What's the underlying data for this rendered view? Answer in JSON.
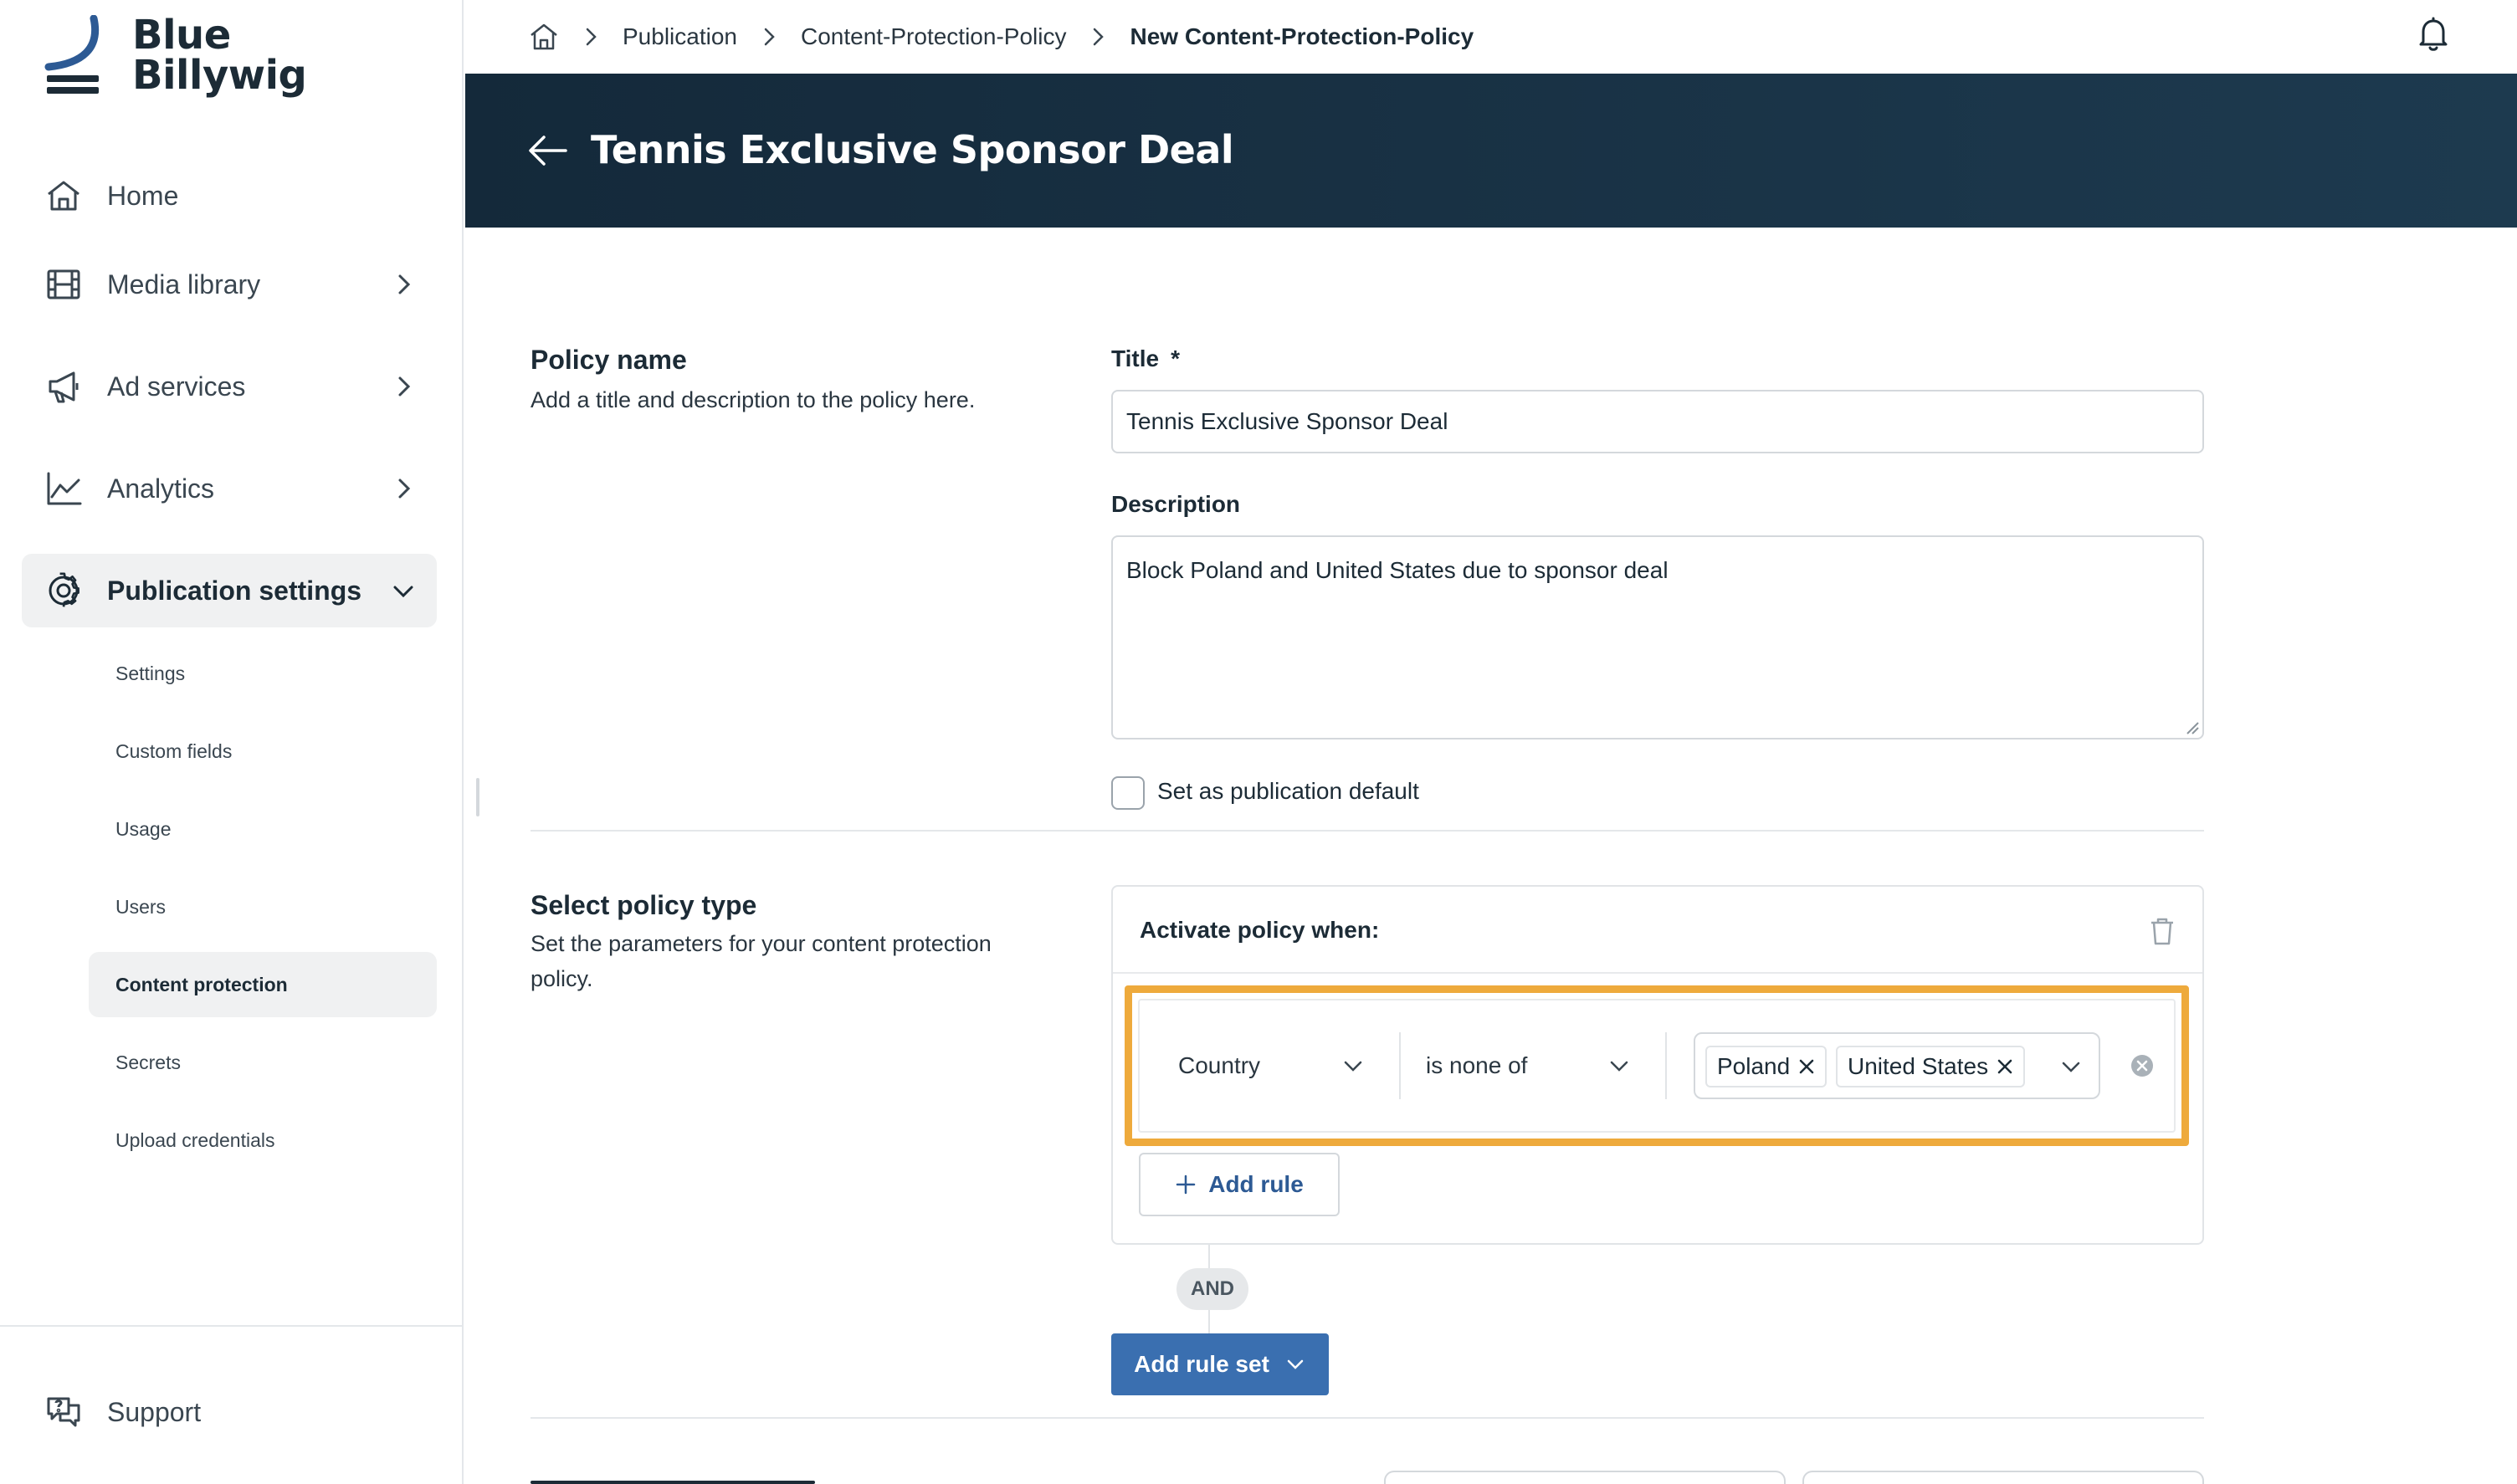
{
  "app": {
    "logo_line1": "Blue",
    "logo_line2": "Billywig"
  },
  "sidebar": {
    "items": [
      {
        "label": "Home",
        "icon": "home-icon"
      },
      {
        "label": "Media library",
        "icon": "film-icon"
      },
      {
        "label": "Ad services",
        "icon": "megaphone-icon"
      },
      {
        "label": "Analytics",
        "icon": "chart-line-icon"
      },
      {
        "label": "Publication settings",
        "icon": "gear-icon",
        "active": true
      }
    ],
    "sub_items": [
      {
        "label": "Settings"
      },
      {
        "label": "Custom fields"
      },
      {
        "label": "Usage"
      },
      {
        "label": "Users"
      },
      {
        "label": "Content protection",
        "active": true
      },
      {
        "label": "Secrets"
      },
      {
        "label": "Upload credentials"
      }
    ],
    "support_label": "Support"
  },
  "breadcrumb": {
    "items": [
      "Publication",
      "Content-Protection-Policy",
      "New Content-Protection-Policy"
    ]
  },
  "header": {
    "title": "Tennis Exclusive Sponsor Deal"
  },
  "policy_name": {
    "heading": "Policy name",
    "description": "Add a title and description to the policy here.",
    "title_label": "Title",
    "required_mark": "*",
    "title_value": "Tennis Exclusive Sponsor Deal",
    "description_label": "Description",
    "description_value": "Block Poland and United States due to sponsor deal",
    "default_checkbox_label": "Set as publication default",
    "default_checked": false
  },
  "policy_type": {
    "heading": "Select policy type",
    "description": "Set the parameters for your content protection policy.",
    "activate_label": "Activate policy when:",
    "rule": {
      "field": "Country",
      "operator": "is none of",
      "values": [
        "Poland",
        "United States"
      ]
    },
    "add_rule_label": "Add rule",
    "and_label": "AND",
    "add_rule_set_label": "Add rule set"
  },
  "colors": {
    "banner": "#14293a",
    "highlight": "#eeaa3c",
    "primary_button": "#3a6fb0",
    "link": "#2d5a94"
  }
}
